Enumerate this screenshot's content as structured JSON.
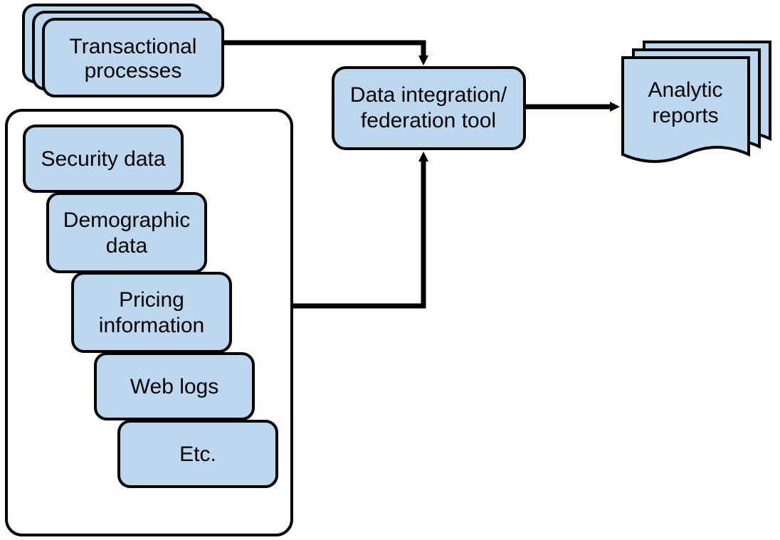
{
  "nodes": {
    "transactional": {
      "line1": "Transactional",
      "line2": "processes"
    },
    "integration": {
      "line1": "Data integration/",
      "line2": "federation tool"
    },
    "reports": {
      "line1": "Analytic",
      "line2": "reports"
    },
    "sources": {
      "security": "Security data",
      "demographic": {
        "line1": "Demographic",
        "line2": "data"
      },
      "pricing": {
        "line1": "Pricing",
        "line2": "information"
      },
      "weblogs": "Web logs",
      "etc": "Etc."
    }
  },
  "colors": {
    "fill": "#bdd7ee",
    "stroke": "#000000"
  }
}
